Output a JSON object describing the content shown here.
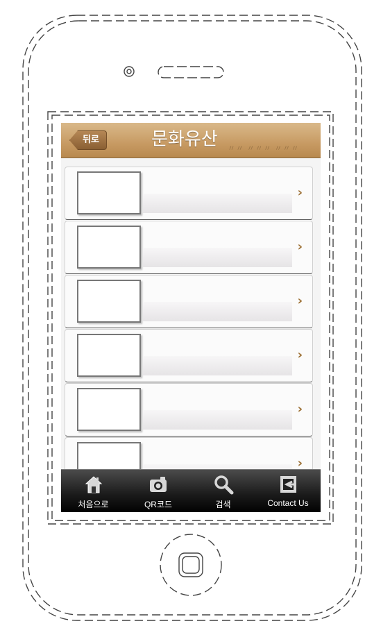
{
  "navbar": {
    "back_label": "뒤로",
    "title": "문화유산"
  },
  "list": {
    "rows": [
      {
        "chevron": "›"
      },
      {
        "chevron": "›"
      },
      {
        "chevron": "›"
      },
      {
        "chevron": "›"
      },
      {
        "chevron": "›"
      },
      {
        "chevron": "›"
      }
    ]
  },
  "tabbar": {
    "items": [
      {
        "label": "처음으로",
        "icon": "home-icon"
      },
      {
        "label": "QR코드",
        "icon": "camera-icon"
      },
      {
        "label": "검색",
        "icon": "search-icon"
      },
      {
        "label": "Contact Us",
        "icon": "contact-icon"
      }
    ]
  },
  "colors": {
    "nav_brown": "#c79a63",
    "chevron": "#9c6f33",
    "tabbar": "#1d1d1d"
  }
}
